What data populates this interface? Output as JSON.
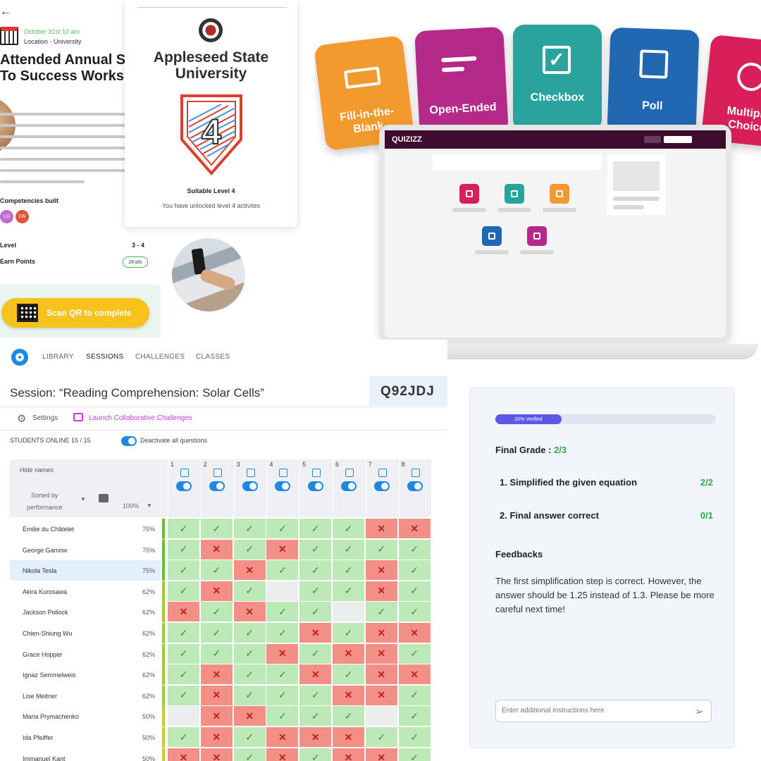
{
  "event": {
    "back": "←",
    "date": "October 31st 10 am",
    "location": "Location - University",
    "title": "Attended Annual Steps To Success Workshops",
    "competencies_label": "Competencies built",
    "chips": [
      {
        "text": "LD",
        "color": "#c06bd6"
      },
      {
        "text": "LW",
        "color": "#e0553a"
      }
    ],
    "level_label": "Level",
    "level_value": "3 - 4",
    "points_label": "Earn Points",
    "points_value": "20 pts",
    "scan_label": "Scan QR to complete"
  },
  "badge": {
    "university": "Appleseed State University",
    "shield_number": "4",
    "level_title": "Suitable Level 4",
    "unlock_text": "You have unlocked level 4 activites"
  },
  "quizizz": {
    "brand": "QUIZIZZ",
    "tiles": [
      {
        "label": "Fill-in-the-Blank",
        "color": "#f39a2f"
      },
      {
        "label": "Open-Ended",
        "color": "#b52a89"
      },
      {
        "label": "Checkbox",
        "color": "#2aa39e"
      },
      {
        "label": "Poll",
        "color": "#2267b1"
      },
      {
        "label": "Multiple Choice",
        "color": "#d81f5a"
      }
    ],
    "buttons": [
      {
        "color": "#d81f5a"
      },
      {
        "color": "#2aa39e"
      },
      {
        "color": "#f39a2f"
      },
      {
        "color": "#2267b1"
      },
      {
        "color": "#b52a89"
      }
    ]
  },
  "dashboard": {
    "nav": [
      "LIBRARY",
      "SESSIONS",
      "CHALLENGES",
      "CLASSES"
    ],
    "session_title": "Session: “Reading Comprehension: Solar Cells”",
    "code": "Q92JDJ",
    "settings": "Settings",
    "launch": "Launch Collaborative Challenges",
    "online": "STUDENTS ONLINE 15 / 15",
    "deactivate": "Deactivate all questions",
    "hide_names": "Hide names",
    "sorted_by": "Sorted by",
    "performance": "performance",
    "threshold": "100%",
    "questions": [
      "1",
      "2",
      "3",
      "4",
      "5",
      "6",
      "7",
      "8"
    ],
    "students": [
      {
        "name": "Émilie du Châtelet",
        "pct": "75%",
        "bar": "#6cbd3a",
        "r": "YYYYYYNN"
      },
      {
        "name": "George Gamow",
        "pct": "75%",
        "bar": "#6cbd3a",
        "r": "YNYNYYYY"
      },
      {
        "name": "Nikola Tesla",
        "pct": "75%",
        "bar": "#6cbd3a",
        "r": "YYNYYYNY"
      },
      {
        "name": "Akira Kurosawa",
        "pct": "62%",
        "bar": "#a2c93a",
        "r": "YNYEYYNY"
      },
      {
        "name": "Jackson Pollock",
        "pct": "62%",
        "bar": "#a2c93a",
        "r": "NYNYYEYY"
      },
      {
        "name": "Chien-Shiung Wu",
        "pct": "62%",
        "bar": "#a2c93a",
        "r": "YYYYNYNN"
      },
      {
        "name": "Grace Hopper",
        "pct": "62%",
        "bar": "#a2c93a",
        "r": "YYYNYNNY"
      },
      {
        "name": "Ignaz Semmelweis",
        "pct": "62%",
        "bar": "#a2c93a",
        "r": "YNYYNYNN"
      },
      {
        "name": "Lise Meitner",
        "pct": "62%",
        "bar": "#a2c93a",
        "r": "YNYYYNNY"
      },
      {
        "name": "Maria Prymachenko",
        "pct": "50%",
        "bar": "#c9c93a",
        "r": "ENNYYYEY"
      },
      {
        "name": "Ida Pfeiffer",
        "pct": "50%",
        "bar": "#c9c93a",
        "r": "YNYNNNYY"
      },
      {
        "name": "Immanuel Kant",
        "pct": "50%",
        "bar": "#c9c93a",
        "r": "NNYNYNNY"
      }
    ]
  },
  "grade": {
    "verified": "20% Verified",
    "verified_fraction": 0.3,
    "final_label": "Final Grade : ",
    "final_value": "2/3",
    "criteria": [
      {
        "label": "1. Simplified the given equation",
        "value": "2/2"
      },
      {
        "label": "2. Final answer correct",
        "value": "0/1"
      }
    ],
    "feedback_title": "Feedbacks",
    "feedback_text": "The first simplification step is correct. However, the answer should be 1.25 instead of 1.3. Please be more careful next time!",
    "input_placeholder": "Enter additional instructions here"
  }
}
